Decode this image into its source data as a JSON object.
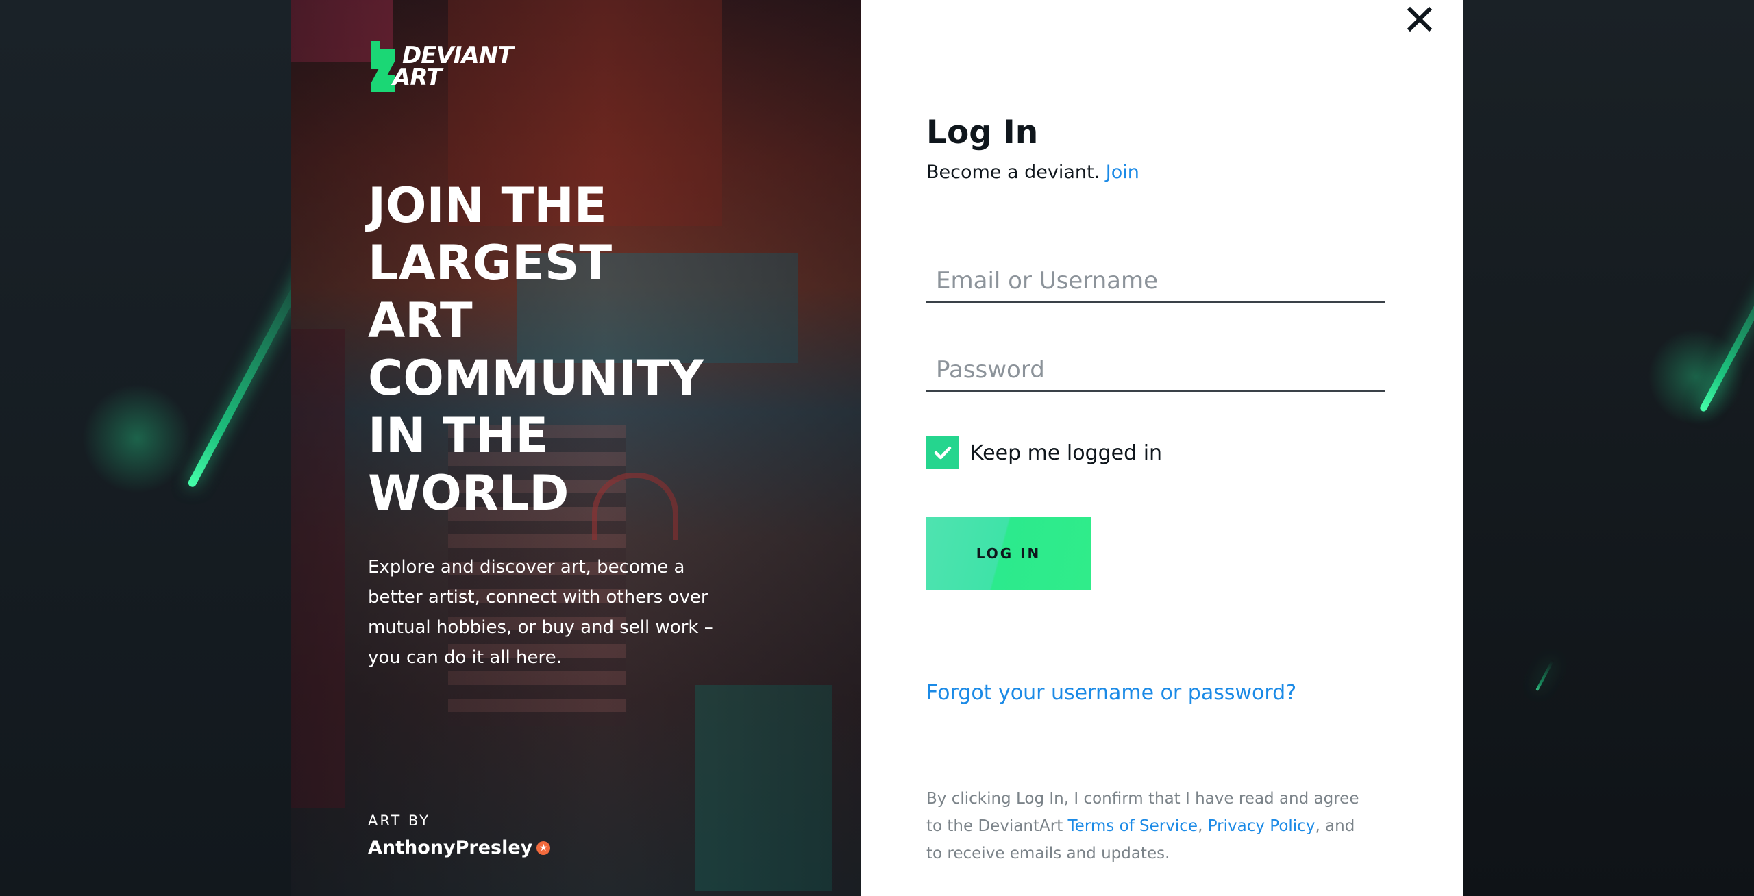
{
  "brand": {
    "logo_line1": "DEVIANT",
    "logo_line2": "ART"
  },
  "promo": {
    "headline_lines": [
      "JOIN THE",
      "LARGEST",
      "ART",
      "COMMUNITY",
      "IN THE",
      "WORLD"
    ],
    "description": "Explore and discover art, become a better artist, connect with others over mutual hobbies, or buy and sell work – you can do it all here.",
    "art_by_label": "ART BY",
    "artist_name": "AnthonyPresley"
  },
  "login": {
    "title": "Log In",
    "subtitle_text": "Become a deviant.",
    "join_link": "Join",
    "username_placeholder": "Email or Username",
    "password_placeholder": "Password",
    "keep_logged_in_label": "Keep me logged in",
    "keep_logged_in_checked": true,
    "submit_label": "LOG IN",
    "forgot_link": "Forgot your username or password?",
    "legal_prefix": "By clicking Log In, I confirm that I have read and agree to the DeviantArt",
    "terms_link": "Terms of Service",
    "privacy_link": "Privacy Policy",
    "legal_suffix": ", and to receive emails and updates."
  },
  "icons": {
    "close": "close-icon",
    "check": "checkmark-icon",
    "badge": "star-badge-icon"
  },
  "colors": {
    "accent_green": "#25d58e",
    "link_blue": "#1b8ae6",
    "text_dark": "#0f161c",
    "badge_orange": "#f26a3d"
  }
}
